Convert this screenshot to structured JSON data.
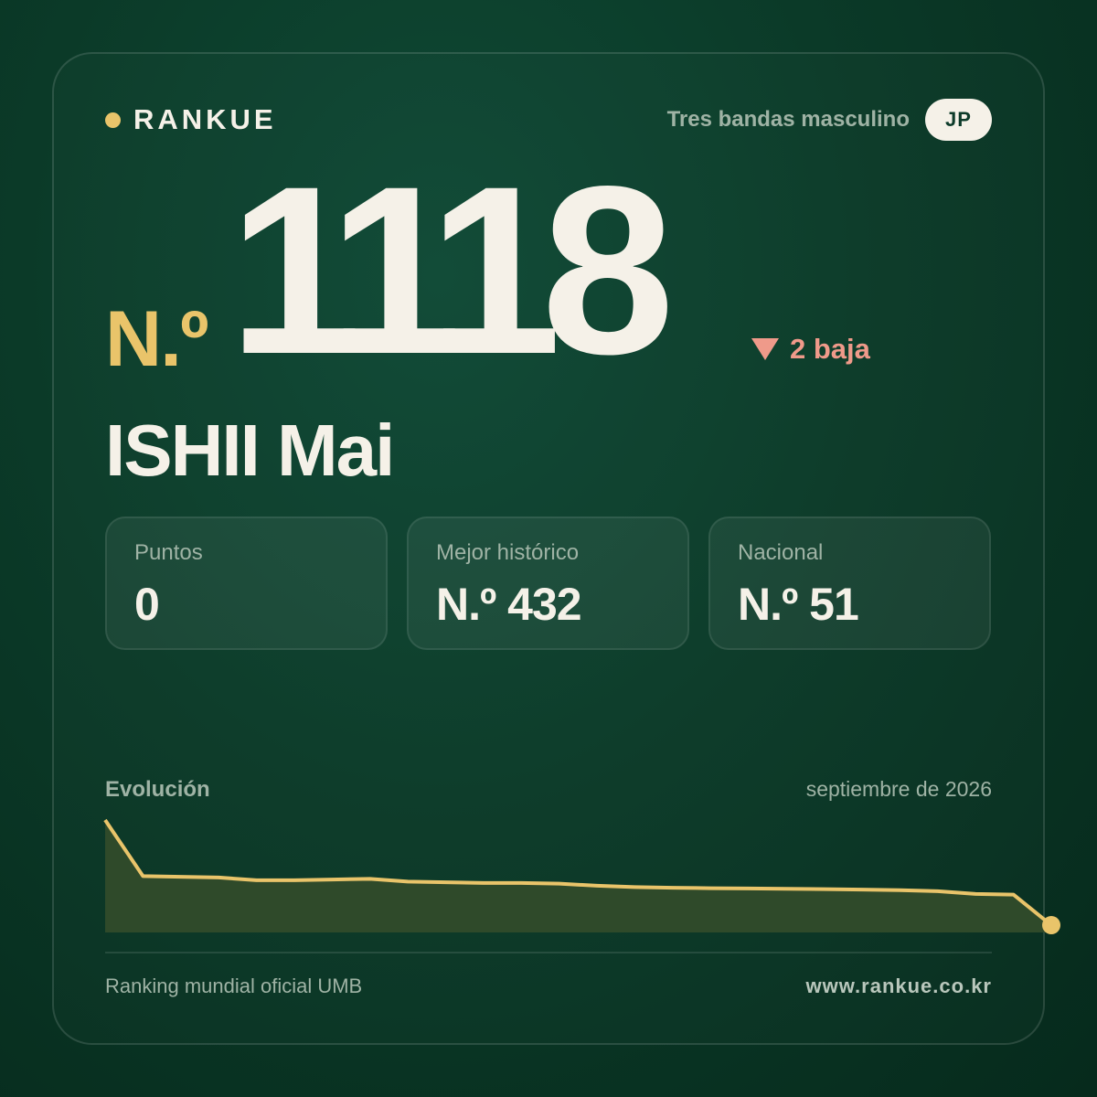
{
  "brand": {
    "name": "RANKUE",
    "accent": "#e9c46a"
  },
  "header": {
    "category": "Tres bandas masculino",
    "country": "JP"
  },
  "rank": {
    "prefix": "N.º",
    "value": "1118",
    "change": "2 baja",
    "change_color": "#ef9a8a",
    "change_icon": "triangle-down-icon"
  },
  "player": {
    "name": "ISHII Mai"
  },
  "stats": [
    {
      "label": "Puntos",
      "value": "0"
    },
    {
      "label": "Mejor histórico",
      "value": "N.º 432"
    },
    {
      "label": "Nacional",
      "value": "N.º 51"
    }
  ],
  "evolution": {
    "label": "Evolución",
    "date": "septiembre de 2026"
  },
  "chart_data": {
    "type": "area",
    "title": "",
    "xlabel": "",
    "ylabel": "",
    "line_color": "#e9c46a",
    "fill_color": "#2f4a2a",
    "y_inverted": true,
    "ylim": [
      1118,
      350
    ],
    "series": [
      {
        "values": [
          350,
          760,
          765,
          770,
          790,
          790,
          785,
          780,
          800,
          805,
          810,
          810,
          815,
          830,
          840,
          845,
          848,
          850,
          852,
          855,
          858,
          862,
          870,
          890,
          895,
          1118
        ]
      }
    ]
  },
  "footer": {
    "source": "Ranking mundial oficial UMB",
    "url": "www.rankue.co.kr"
  }
}
